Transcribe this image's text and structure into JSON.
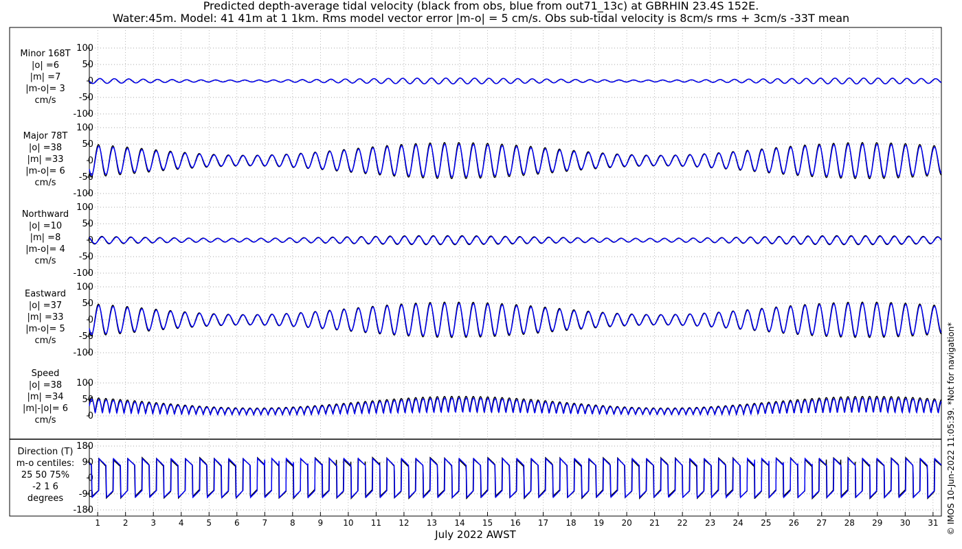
{
  "title_line1": "Predicted depth-average tidal velocity (black from obs, blue from out71_13c) at GBRHIN 23.4S 152E.",
  "title_line2": "Water:45m. Model: 41 41m at 1 1km. Rms model vector error |m-o| = 5 cm/s. Obs sub-tidal velocity is 8cm/s rms + 3cm/s -33T mean",
  "watermark": "© IMOS 10-Jun-2022 11:05:39. *Not for navigation*",
  "colors": {
    "obs": "#000000",
    "model": "#0000ff",
    "grid": "#888888",
    "frame": "#000000"
  },
  "chart_data": {
    "type": "line",
    "xlabel": "July 2022 AWST",
    "x_ticks": [
      1,
      2,
      3,
      4,
      5,
      6,
      7,
      8,
      9,
      10,
      11,
      12,
      13,
      14,
      15,
      16,
      17,
      18,
      19,
      20,
      21,
      22,
      23,
      24,
      25,
      26,
      27,
      28,
      29,
      30,
      31
    ],
    "xlim": [
      0.7,
      31.3
    ],
    "tidal_periods_hours": [
      12.42,
      12.0
    ],
    "series_legend": [
      "black from obs",
      "blue from out71_13c"
    ],
    "panels": [
      {
        "id": "minor",
        "label_lines": [
          "Minor 168T",
          "|o| =6",
          "|m| =7",
          "|m-o|= 3",
          "cm/s"
        ],
        "ylim": [
          -100,
          100
        ],
        "yticks": [
          -100,
          -50,
          0,
          50,
          100
        ],
        "obs_amplitude": 9,
        "model_amplitude": 9,
        "mean": 0,
        "kind": "velocity"
      },
      {
        "id": "major",
        "label_lines": [
          "Major 78T",
          "|o| =38",
          "|m| =33",
          "|m-o|= 6",
          "cm/s"
        ],
        "ylim": [
          -100,
          100
        ],
        "yticks": [
          -100,
          -50,
          0,
          50,
          100
        ],
        "obs_amplitude": 55,
        "model_amplitude": 50,
        "mean": 0,
        "kind": "velocity"
      },
      {
        "id": "northward",
        "label_lines": [
          "Northward",
          "|o| =10",
          "|m| =8",
          "|m-o|= 4",
          "cm/s"
        ],
        "ylim": [
          -100,
          100
        ],
        "yticks": [
          -100,
          -50,
          0,
          50,
          100
        ],
        "obs_amplitude": 15,
        "model_amplitude": 13,
        "mean": 0,
        "kind": "velocity"
      },
      {
        "id": "eastward",
        "label_lines": [
          "Eastward",
          "|o| =37",
          "|m| =33",
          "|m-o|= 5",
          "cm/s"
        ],
        "ylim": [
          -100,
          100
        ],
        "yticks": [
          -100,
          -50,
          0,
          50,
          100
        ],
        "obs_amplitude": 54,
        "model_amplitude": 50,
        "mean": 0,
        "kind": "velocity"
      },
      {
        "id": "speed",
        "label_lines": [
          "Speed",
          "|o| =38",
          "|m| =34",
          "|m|-|o|= 6",
          "cm/s"
        ],
        "ylim": [
          0,
          100
        ],
        "yticks": [
          0,
          50,
          100
        ],
        "obs_amplitude": 55,
        "model_amplitude": 50,
        "mean": 0,
        "kind": "speed"
      },
      {
        "id": "direction",
        "label_lines": [
          "Direction (T)",
          "m-o centiles:",
          "25  50  75%",
          "-2  1  6",
          "degrees"
        ],
        "ylim": [
          -180,
          180
        ],
        "yticks": [
          -180,
          -90,
          0,
          90,
          180
        ],
        "obs_amplitude": 0,
        "model_amplitude": 0,
        "mean": 0,
        "kind": "direction"
      }
    ]
  }
}
